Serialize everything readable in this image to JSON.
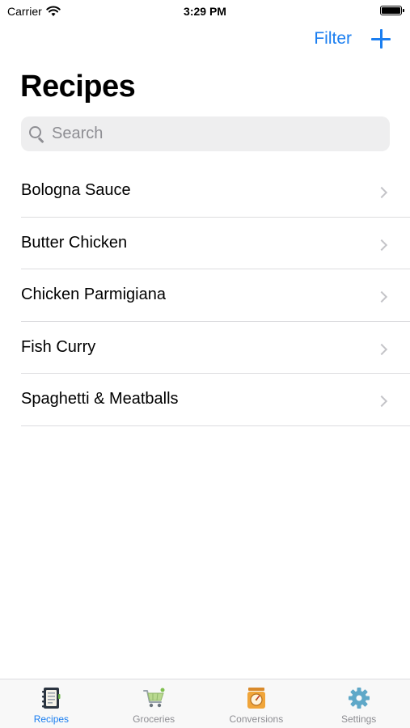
{
  "status_bar": {
    "carrier": "Carrier",
    "time": "3:29 PM"
  },
  "nav": {
    "filter_label": "Filter",
    "add_icon": "plus-icon"
  },
  "title": "Recipes",
  "search": {
    "placeholder": "Search",
    "value": ""
  },
  "recipes": [
    {
      "name": "Bologna Sauce"
    },
    {
      "name": "Butter Chicken"
    },
    {
      "name": "Chicken Parmigiana"
    },
    {
      "name": "Fish Curry"
    },
    {
      "name": "Spaghetti & Meatballs"
    }
  ],
  "tabs": [
    {
      "label": "Recipes",
      "icon": "recipe-book-icon",
      "active": true
    },
    {
      "label": "Groceries",
      "icon": "shopping-cart-icon",
      "active": false
    },
    {
      "label": "Conversions",
      "icon": "kitchen-scale-icon",
      "active": false
    },
    {
      "label": "Settings",
      "icon": "gear-icon",
      "active": false
    }
  ],
  "colors": {
    "accent": "#1a7ef0",
    "inactive": "#8e8e93",
    "separator": "#dcdcdf",
    "search_bg": "#eeeeef"
  }
}
